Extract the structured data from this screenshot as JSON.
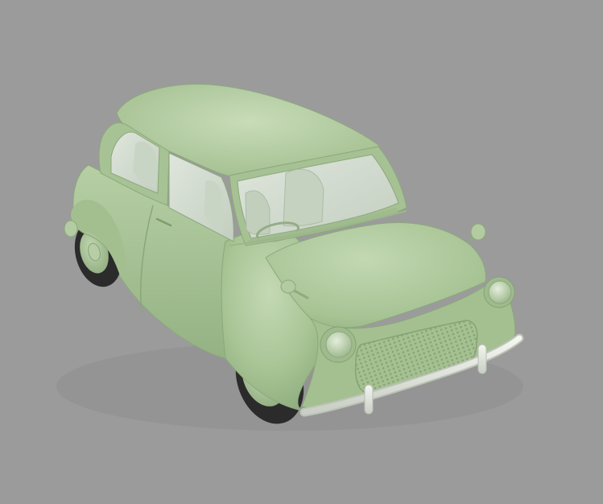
{
  "viewport": {
    "background_color": "#9b9b9b"
  },
  "model": {
    "subject": "car-3d-model",
    "body_color": "#a9c596",
    "body_shadow_color": "#8fae7f",
    "body_highlight_color": "#c6dbb7",
    "glass_color": "#d4ddd2",
    "interior_color": "#c9d5c4",
    "chrome_color": "#e4e9e0",
    "tire_color": "#2b2b2b"
  }
}
